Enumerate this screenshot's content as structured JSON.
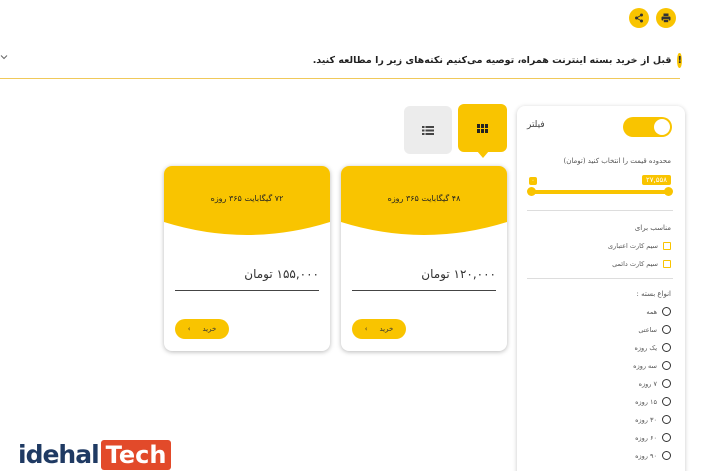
{
  "header": {
    "share_icon": "share-icon",
    "print_icon": "print-icon"
  },
  "notice": {
    "text": "قبل از خرید بسته اینترنت همراه، توصیه می‌کنیم نکته‌های زیر را مطالعه کنید.",
    "icon_text": "!"
  },
  "view": {
    "grid_icon": "grid-icon",
    "list_icon": "list-icon"
  },
  "cards": [
    {
      "title": "۴۸ گیگابایت ۳۶۵ روزه",
      "price": "۱۲۰,۰۰۰ تومان",
      "buy_label": "خرید",
      "buy_arrow": "›"
    },
    {
      "title": "۷۲ گیگابایت ۳۶۵ روزه",
      "price": "۱۵۵,۰۰۰ تومان",
      "buy_label": "خرید",
      "buy_arrow": "›"
    }
  ],
  "sidebar": {
    "filter_label": "فیلتر",
    "price_caption": "محدوده قیمت را انتخاب کنید (تومان)",
    "price_min": "۰",
    "price_max": "۲۷,۵۵۸",
    "suitable_label": "مناسب برای",
    "suitable_options": [
      "سیم کارت اعتباری",
      "سیم کارت دائمی"
    ],
    "types_label": "انواع بسته :",
    "type_options": [
      "همه",
      "ساعتی",
      "یک روزه",
      "سه روزه",
      "۷ روزه",
      "۱۵ روزه",
      "۳۰ روزه",
      "۶۰ روزه",
      "۹۰ روزه"
    ]
  },
  "logo": {
    "left": "idehal",
    "right": "Tech"
  },
  "colors": {
    "accent": "#f9c400",
    "logo_blue": "#1f3a63",
    "logo_red": "#e24a2a"
  }
}
